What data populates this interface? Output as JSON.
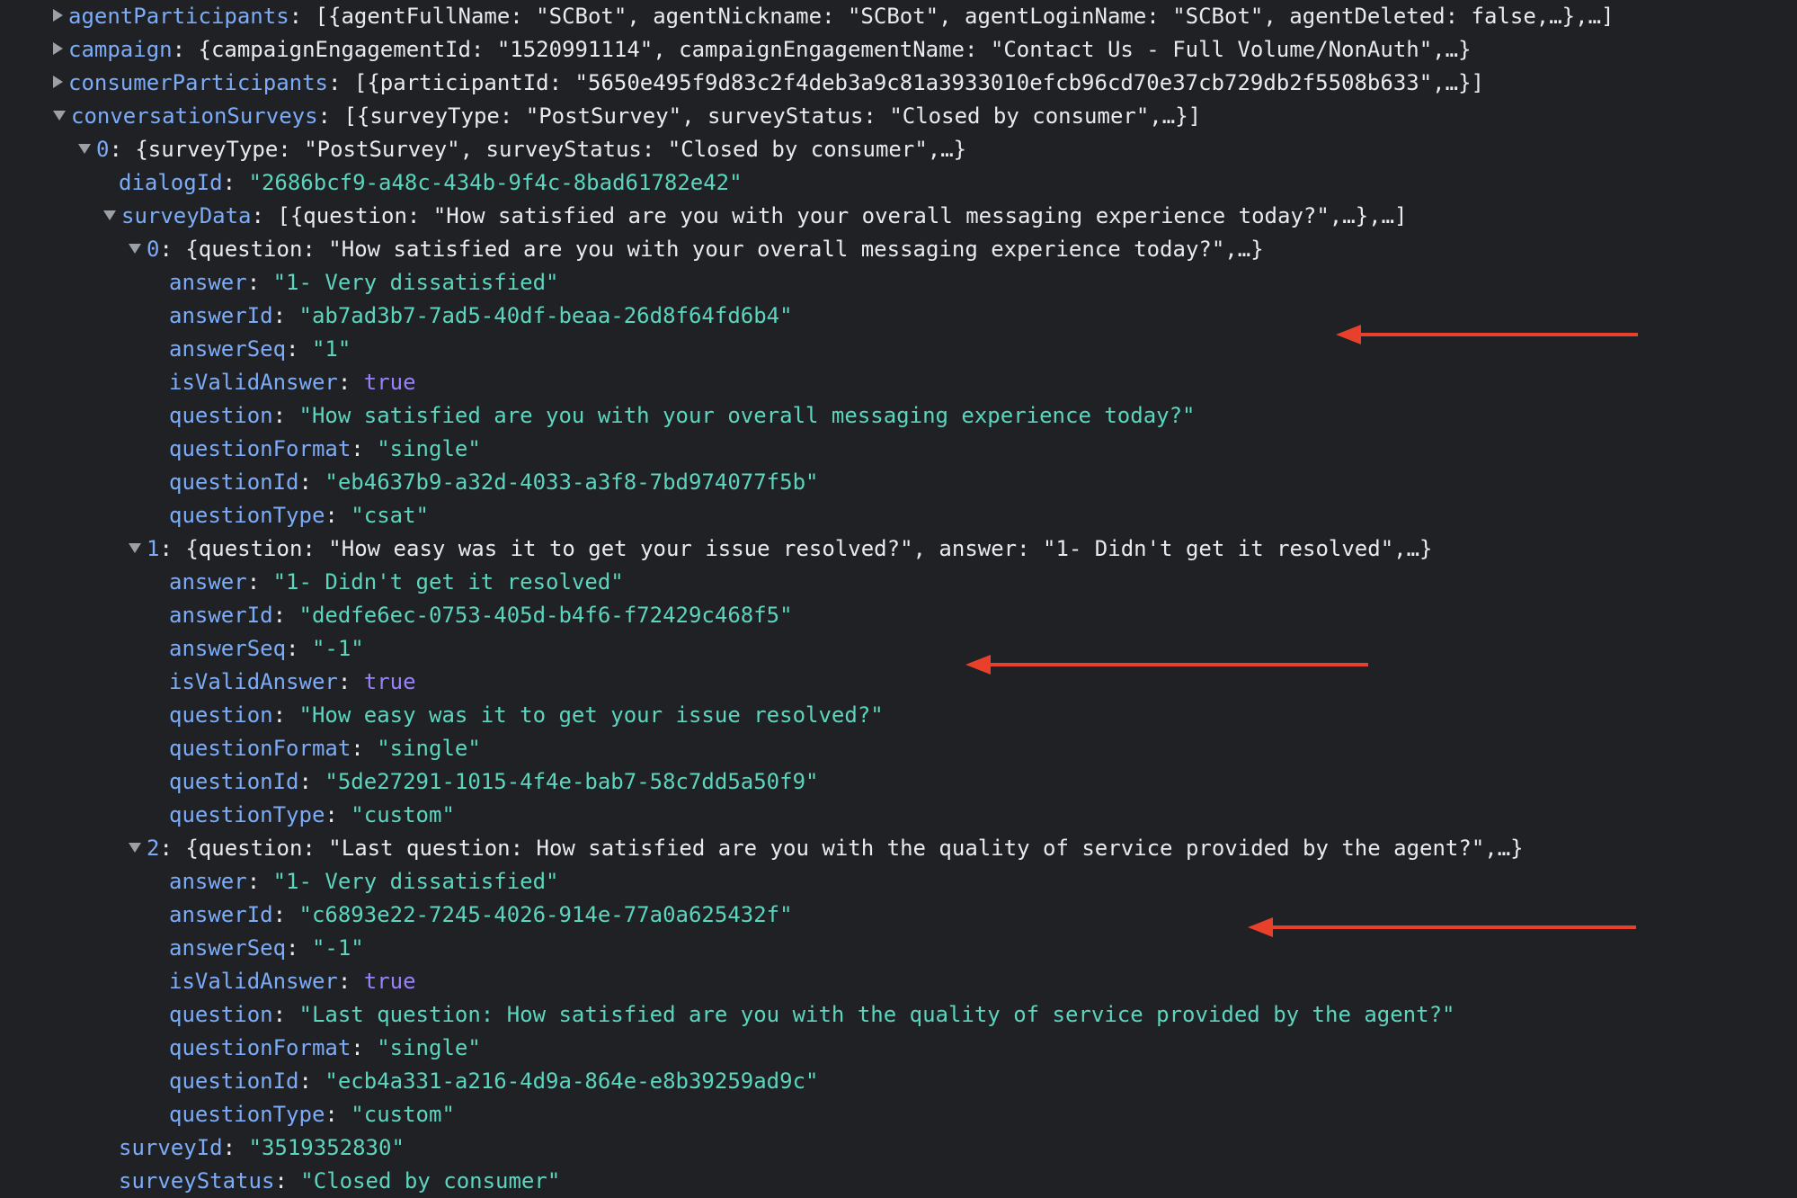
{
  "panel": {
    "lines": [
      {
        "indent": 0,
        "toggle": "collapsed",
        "key": "agentParticipants",
        "summary": "[{agentFullName: \"SCBot\", agentNickname: \"SCBot\", agentLoginName: \"SCBot\", agentDeleted: false,…},…]"
      },
      {
        "indent": 0,
        "toggle": "collapsed",
        "key": "campaign",
        "summary": "{campaignEngagementId: \"1520991114\", campaignEngagementName: \"Contact Us - Full Volume/NonAuth\",…}"
      },
      {
        "indent": 0,
        "toggle": "collapsed",
        "key": "consumerParticipants",
        "summary": "[{participantId: \"5650e495f9d83c2f4deb3a9c81a3933010efcb96cd70e37cb729db2f5508b633\",…}]"
      },
      {
        "indent": 0,
        "toggle": "expanded",
        "key": "conversationSurveys",
        "summary": "[{surveyType: \"PostSurvey\", surveyStatus: \"Closed by consumer\",…}]"
      },
      {
        "indent": 1,
        "toggle": "expanded",
        "key": "0",
        "summary": "{surveyType: \"PostSurvey\", surveyStatus: \"Closed by consumer\",…}"
      },
      {
        "indent": 2,
        "toggle": "none",
        "key": "dialogId",
        "value": "\"2686bcf9-a48c-434b-9f4c-8bad61782e42\"",
        "vtype": "str"
      },
      {
        "indent": 2,
        "toggle": "expanded",
        "key": "surveyData",
        "summary": "[{question: \"How satisfied are you with your overall messaging experience today?\",…},…]"
      },
      {
        "indent": 3,
        "toggle": "expanded",
        "key": "0",
        "summary": "{question: \"How satisfied are you with your overall messaging experience today?\",…}"
      },
      {
        "indent": 4,
        "toggle": "none",
        "key": "answer",
        "value": "\"1- Very dissatisfied\"",
        "vtype": "str"
      },
      {
        "indent": 4,
        "toggle": "none",
        "key": "answerId",
        "value": "\"ab7ad3b7-7ad5-40df-beaa-26d8f64fd6b4\"",
        "vtype": "str"
      },
      {
        "indent": 4,
        "toggle": "none",
        "key": "answerSeq",
        "value": "\"1\"",
        "vtype": "str"
      },
      {
        "indent": 4,
        "toggle": "none",
        "key": "isValidAnswer",
        "value": "true",
        "vtype": "bool"
      },
      {
        "indent": 4,
        "toggle": "none",
        "key": "question",
        "value": "\"How satisfied are you with your overall messaging experience today?\"",
        "vtype": "str"
      },
      {
        "indent": 4,
        "toggle": "none",
        "key": "questionFormat",
        "value": "\"single\"",
        "vtype": "str"
      },
      {
        "indent": 4,
        "toggle": "none",
        "key": "questionId",
        "value": "\"eb4637b9-a32d-4033-a3f8-7bd974077f5b\"",
        "vtype": "str"
      },
      {
        "indent": 4,
        "toggle": "none",
        "key": "questionType",
        "value": "\"csat\"",
        "vtype": "str"
      },
      {
        "indent": 3,
        "toggle": "expanded",
        "key": "1",
        "summary": "{question: \"How easy was it to get your issue resolved?\", answer: \"1- Didn't get it resolved\",…}"
      },
      {
        "indent": 4,
        "toggle": "none",
        "key": "answer",
        "value": "\"1- Didn't get it resolved\"",
        "vtype": "str"
      },
      {
        "indent": 4,
        "toggle": "none",
        "key": "answerId",
        "value": "\"dedfe6ec-0753-405d-b4f6-f72429c468f5\"",
        "vtype": "str"
      },
      {
        "indent": 4,
        "toggle": "none",
        "key": "answerSeq",
        "value": "\"-1\"",
        "vtype": "str"
      },
      {
        "indent": 4,
        "toggle": "none",
        "key": "isValidAnswer",
        "value": "true",
        "vtype": "bool"
      },
      {
        "indent": 4,
        "toggle": "none",
        "key": "question",
        "value": "\"How easy was it to get your issue resolved?\"",
        "vtype": "str"
      },
      {
        "indent": 4,
        "toggle": "none",
        "key": "questionFormat",
        "value": "\"single\"",
        "vtype": "str"
      },
      {
        "indent": 4,
        "toggle": "none",
        "key": "questionId",
        "value": "\"5de27291-1015-4f4e-bab7-58c7dd5a50f9\"",
        "vtype": "str"
      },
      {
        "indent": 4,
        "toggle": "none",
        "key": "questionType",
        "value": "\"custom\"",
        "vtype": "str"
      },
      {
        "indent": 3,
        "toggle": "expanded",
        "key": "2",
        "summary": "{question: \"Last question: How satisfied are you with the quality of service provided by the agent?\",…}"
      },
      {
        "indent": 4,
        "toggle": "none",
        "key": "answer",
        "value": "\"1- Very dissatisfied\"",
        "vtype": "str"
      },
      {
        "indent": 4,
        "toggle": "none",
        "key": "answerId",
        "value": "\"c6893e22-7245-4026-914e-77a0a625432f\"",
        "vtype": "str"
      },
      {
        "indent": 4,
        "toggle": "none",
        "key": "answerSeq",
        "value": "\"-1\"",
        "vtype": "str"
      },
      {
        "indent": 4,
        "toggle": "none",
        "key": "isValidAnswer",
        "value": "true",
        "vtype": "bool"
      },
      {
        "indent": 4,
        "toggle": "none",
        "key": "question",
        "value": "\"Last question: How satisfied are you with the quality of service provided by the agent?\"",
        "vtype": "str"
      },
      {
        "indent": 4,
        "toggle": "none",
        "key": "questionFormat",
        "value": "\"single\"",
        "vtype": "str"
      },
      {
        "indent": 4,
        "toggle": "none",
        "key": "questionId",
        "value": "\"ecb4a331-a216-4d9a-864e-e8b39259ad9c\"",
        "vtype": "str"
      },
      {
        "indent": 4,
        "toggle": "none",
        "key": "questionType",
        "value": "\"custom\"",
        "vtype": "str"
      },
      {
        "indent": 2,
        "toggle": "none",
        "key": "surveyId",
        "value": "\"3519352830\"",
        "vtype": "str"
      },
      {
        "indent": 2,
        "toggle": "none",
        "key": "surveyStatus",
        "value": "\"Closed by consumer\"",
        "vtype": "str"
      }
    ]
  },
  "colors": {
    "background": "#202124",
    "key": "#7cacf8",
    "string": "#5cd5bf",
    "boolean": "#9980ff",
    "text": "#e8eaed",
    "toggle": "#9aa0a6",
    "annotation_arrow": "#e8402a"
  },
  "icons": {
    "collapsed": "triangle-right-icon",
    "expanded": "triangle-down-icon",
    "annotation": "arrow-left-icon"
  }
}
